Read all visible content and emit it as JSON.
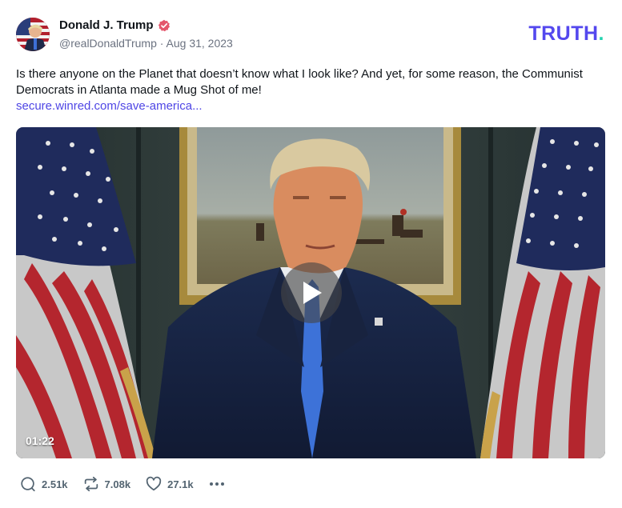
{
  "post": {
    "author": {
      "display_name": "Donald J. Trump",
      "handle_date": "@realDonaldTrump · Aug 31, 2023",
      "verified": true,
      "avatar_icon": "avatar-flag-portrait"
    },
    "brand": {
      "logo_main": "TRUTH",
      "logo_dot": ".",
      "color_primary": "#5448ee",
      "color_dot": "#23d3b0"
    },
    "text": "Is there anyone on the Planet that doesn’t know what I look like? And yet, for some reason, the Communist Democrats in Atlanta made a Mug Shot of me!",
    "link": "secure.winred.com/save-america...",
    "video": {
      "duration": "01:22",
      "play_icon": "play-icon"
    },
    "actions": {
      "replies": "2.51k",
      "retruths": "7.08k",
      "likes": "27.1k",
      "more_icon": "more-icon"
    },
    "colors": {
      "link": "#4f46e5",
      "verified": "#e4566b",
      "muted": "#6b7280"
    }
  }
}
